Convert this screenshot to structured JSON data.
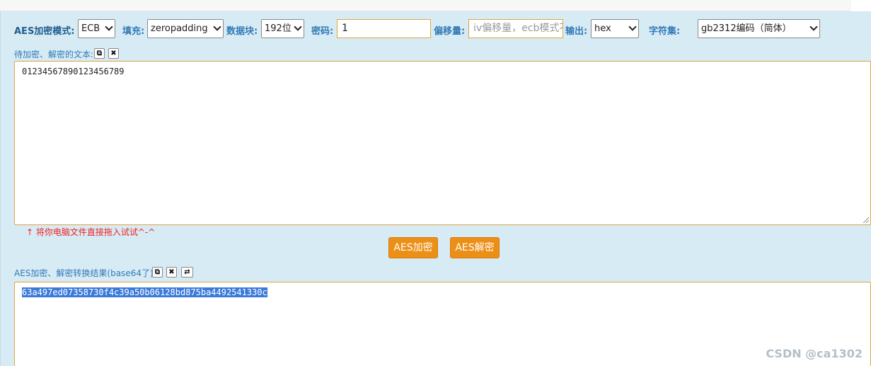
{
  "toolbar": {
    "mode_label": "AES加密模式:",
    "mode_value": "ECB",
    "padding_label": "填充:",
    "padding_value": "zeropadding",
    "block_label": "数据块:",
    "block_value": "192位",
    "key_label": "密码:",
    "key_value": "1",
    "iv_label": "偏移量:",
    "iv_placeholder": "iv偏移量，ecb模式不用填写！",
    "output_label": "输出:",
    "output_value": "hex",
    "charset_label": "字符集:",
    "charset_value": "gb2312编码（简体）"
  },
  "input_section": {
    "label": "待加密、解密的文本:",
    "copy_icon": "copy-icon",
    "clear_icon": "clear-icon",
    "text": "01234567890123456789",
    "hint": "↑ 将你电脑文件直接拖入试试^-^"
  },
  "actions": {
    "encrypt_label": "AES加密",
    "decrypt_label": "AES解密"
  },
  "output_section": {
    "label": "AES加密、解密转换结果(base64了):",
    "copy_icon": "copy-icon",
    "clear_icon": "clear-icon",
    "swap_icon": "swap-icon",
    "text": "63a497ed07358730f4c39a50b06128bd875ba4492541330c"
  },
  "watermark": "CSDN @ca1302"
}
